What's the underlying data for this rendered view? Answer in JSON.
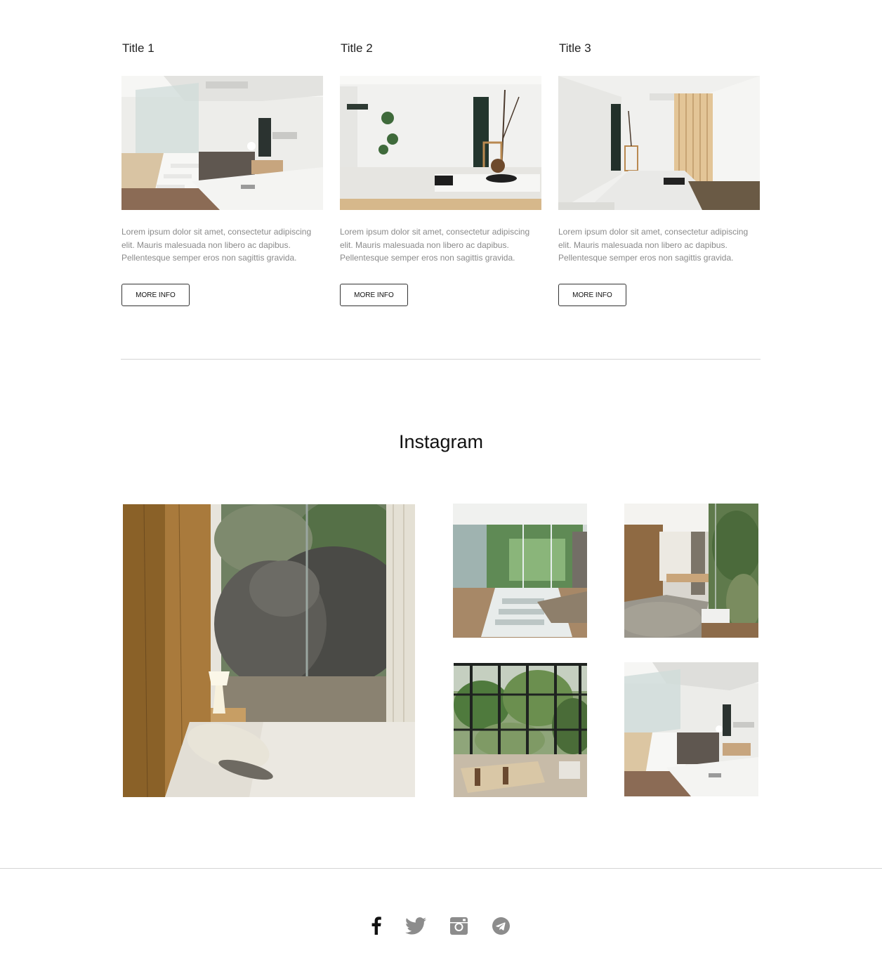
{
  "cards": [
    {
      "title": "Title 1",
      "text": "Lorem ipsum dolor sit amet, consectetur adipiscing elit. Mauris malesuada non libero ac dapibus. Pellentesque semper eros non sagittis gravida.",
      "button_label": "MORE INFO"
    },
    {
      "title": "Title 2",
      "text": "Lorem ipsum dolor sit amet, consectetur adipiscing elit. Mauris malesuada non libero ac dapibus. Pellentesque semper eros non sagittis gravida.",
      "button_label": "MORE INFO"
    },
    {
      "title": "Title 3",
      "text": "Lorem ipsum dolor sit amet, consectetur adipiscing elit. Mauris malesuada non libero ac dapibus. Pellentesque semper eros non sagittis gravida.",
      "button_label": "MORE INFO"
    }
  ],
  "instagram": {
    "title": "Instagram"
  },
  "footer": {
    "social_icons": [
      "facebook-icon",
      "twitter-icon",
      "instagram-icon",
      "telegram-icon"
    ]
  },
  "colors": {
    "text_primary": "#111111",
    "text_muted": "#8a8a8a",
    "divider": "#d4d4d4",
    "icon_active": "#111111",
    "icon_muted": "#8c8c8c"
  }
}
